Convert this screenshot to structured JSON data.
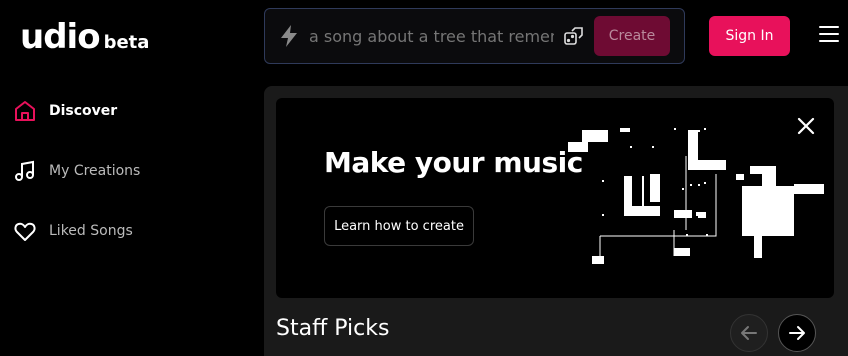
{
  "brand": {
    "name": "udio",
    "tag": "beta"
  },
  "prompt": {
    "placeholder": "a song about a tree that remembers",
    "value": "",
    "create_label": "Create"
  },
  "header": {
    "signin_label": "Sign In"
  },
  "sidebar": {
    "items": [
      {
        "label": "Discover",
        "icon": "home-icon",
        "active": true
      },
      {
        "label": "My Creations",
        "icon": "music-note-icon",
        "active": false
      },
      {
        "label": "Liked Songs",
        "icon": "heart-icon",
        "active": false
      }
    ]
  },
  "hero": {
    "title": "Make your music",
    "cta_label": "Learn how to create"
  },
  "section": {
    "title": "Staff Picks"
  },
  "colors": {
    "accent": "#e8115b",
    "create_disabled": "#6e0b33",
    "panel": "#1a1a1a",
    "background": "#000000"
  }
}
